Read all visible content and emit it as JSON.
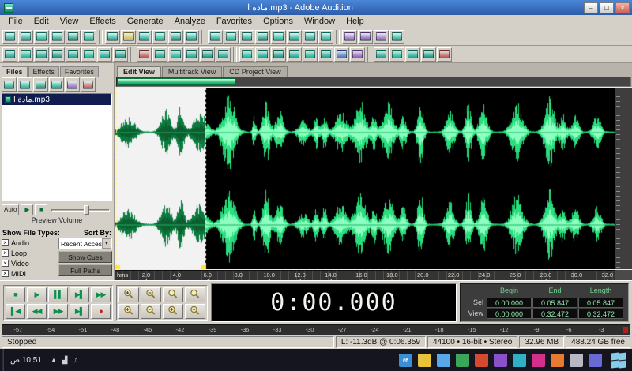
{
  "window": {
    "title": "مادة ا.mp3 - Adobe Audition",
    "controls": [
      {
        "name": "minimize-button",
        "glyph": "–"
      },
      {
        "name": "maximize-button",
        "glyph": "□"
      },
      {
        "name": "close-button",
        "glyph": "×"
      }
    ]
  },
  "menu": {
    "items": [
      "File",
      "Edit",
      "View",
      "Effects",
      "Generate",
      "Analyze",
      "Favorites",
      "Options",
      "Window",
      "Help"
    ]
  },
  "toolbar_row1": [
    {
      "name": "toolbar1-icon-01",
      "color": "#0fa08c"
    },
    {
      "name": "toolbar1-icon-02",
      "color": "#0fa08c"
    },
    {
      "name": "toolbar1-icon-03",
      "color": "#12b096"
    },
    {
      "name": "toolbar1-icon-04",
      "color": "#0fa08c"
    },
    {
      "name": "toolbar1-icon-05",
      "color": "#0d8f7c"
    },
    {
      "name": "toolbar1-icon-06",
      "color": "#12b096"
    },
    {
      "sep": true
    },
    {
      "name": "toolbar1-icon-07",
      "color": "#0fa08c"
    },
    {
      "name": "toolbar1-icon-08",
      "color": "#d4b23c"
    },
    {
      "name": "toolbar1-icon-09",
      "color": "#0fa08c"
    },
    {
      "name": "toolbar1-icon-10",
      "color": "#12b096"
    },
    {
      "name": "toolbar1-icon-11",
      "color": "#0d8f7c"
    },
    {
      "name": "toolbar1-icon-12",
      "color": "#0fa08c"
    },
    {
      "sep": true
    },
    {
      "name": "toolbar1-icon-13",
      "color": "#0fa08c"
    },
    {
      "name": "toolbar1-icon-14",
      "color": "#12b096"
    },
    {
      "name": "toolbar1-icon-15",
      "color": "#0fa08c"
    },
    {
      "name": "toolbar1-icon-16",
      "color": "#0d8f7c"
    },
    {
      "name": "toolbar1-icon-17",
      "color": "#12b096"
    },
    {
      "name": "toolbar1-icon-18",
      "color": "#0fa08c"
    },
    {
      "name": "toolbar1-icon-19",
      "color": "#0fa08c"
    },
    {
      "name": "toolbar1-icon-20",
      "color": "#12b096"
    },
    {
      "sep": true
    },
    {
      "name": "toolbar1-icon-21",
      "color": "#9a50c0"
    },
    {
      "name": "toolbar1-icon-22",
      "color": "#8a44b0"
    },
    {
      "name": "toolbar1-icon-23",
      "color": "#9a50c0"
    },
    {
      "name": "toolbar1-icon-24",
      "color": "#0fa08c"
    }
  ],
  "toolbar_row2": [
    {
      "name": "toolbar2-icon-01",
      "color": "#0fa08c"
    },
    {
      "name": "toolbar2-icon-02",
      "color": "#12b096"
    },
    {
      "name": "toolbar2-icon-03",
      "color": "#0fa08c"
    },
    {
      "name": "toolbar2-icon-04",
      "color": "#0d8f7c"
    },
    {
      "name": "toolbar2-icon-05",
      "color": "#0fa08c"
    },
    {
      "name": "toolbar2-icon-06",
      "color": "#12b096"
    },
    {
      "name": "toolbar2-icon-07",
      "color": "#0fa08c"
    },
    {
      "name": "toolbar2-icon-08",
      "color": "#0d8f7c"
    },
    {
      "sep": true
    },
    {
      "name": "toolbar2-icon-09",
      "color": "#c24848"
    },
    {
      "name": "toolbar2-icon-10",
      "color": "#0fa08c"
    },
    {
      "name": "toolbar2-icon-11",
      "color": "#12b096"
    },
    {
      "name": "toolbar2-icon-12",
      "color": "#0fa08c"
    },
    {
      "name": "toolbar2-icon-13",
      "color": "#0d8f7c"
    },
    {
      "name": "toolbar2-icon-14",
      "color": "#0fa08c"
    },
    {
      "sep": true
    },
    {
      "name": "toolbar2-icon-15",
      "color": "#12b096"
    },
    {
      "name": "toolbar2-icon-16",
      "color": "#0fa08c"
    },
    {
      "name": "toolbar2-icon-17",
      "color": "#0d8f7c"
    },
    {
      "name": "toolbar2-icon-18",
      "color": "#0fa08c"
    },
    {
      "name": "toolbar2-icon-19",
      "color": "#12b096"
    },
    {
      "name": "toolbar2-icon-20",
      "color": "#0fa08c"
    },
    {
      "name": "toolbar2-icon-21",
      "color": "#4868c8"
    },
    {
      "name": "toolbar2-icon-22",
      "color": "#9a50c0"
    },
    {
      "sep": true
    },
    {
      "name": "toolbar2-icon-23",
      "color": "#0fa08c"
    },
    {
      "name": "toolbar2-icon-24",
      "color": "#12b096"
    },
    {
      "name": "toolbar2-icon-25",
      "color": "#0fa08c"
    },
    {
      "name": "toolbar2-icon-26",
      "color": "#0d8f7c"
    },
    {
      "name": "toolbar2-icon-27",
      "color": "#c24848"
    }
  ],
  "files_panel": {
    "tabs": [
      {
        "label": "Files",
        "active": true
      },
      {
        "label": "Effects",
        "active": false
      },
      {
        "label": "Favorites",
        "active": false
      }
    ],
    "toolbar": [
      {
        "name": "files-import-icon",
        "color": "#0fa08c"
      },
      {
        "name": "files-close-file-icon",
        "color": "#12b096"
      },
      {
        "name": "files-edit-icon",
        "color": "#0d8f7c"
      },
      {
        "name": "files-insert-multitrack-icon",
        "color": "#0fa08c"
      },
      {
        "name": "files-insert-cd-icon",
        "color": "#9a50c0"
      },
      {
        "name": "files-delete-icon",
        "color": "#c24848"
      }
    ],
    "items": [
      {
        "label": "مادة ا.mp3",
        "selected": true
      }
    ],
    "auto_label": "Auto",
    "preview_buttons": [
      {
        "name": "preview-play-button",
        "glyph": "▶"
      },
      {
        "name": "preview-stop-button",
        "glyph": "■"
      }
    ],
    "preview_volume_label": "Preview Volume",
    "show_file_types_label": "Show File Types:",
    "sort_by_label": "Sort By:",
    "file_types": [
      {
        "label": "Audio",
        "checked": true
      },
      {
        "label": "Loop",
        "checked": true
      },
      {
        "label": "Video",
        "checked": true
      },
      {
        "label": "MIDI",
        "checked": true
      }
    ],
    "sort_value": "Recent Access",
    "buttons": [
      {
        "name": "show-cues-button",
        "label": "Show Cues"
      },
      {
        "name": "full-paths-button",
        "label": "Full Paths"
      }
    ]
  },
  "view_tabs": [
    {
      "label": "Edit View",
      "active": true
    },
    {
      "label": "Multitrack View",
      "active": false
    },
    {
      "label": "CD Project View",
      "active": false
    }
  ],
  "waveform": {
    "duration_s": 32.472,
    "selection_start_s": 0.0,
    "selection_end_s": 5.847,
    "cursor_s": 0.0,
    "color_wave": "#2ade7e",
    "color_wave_core": "#8dffc0",
    "color_wave_selected": "#0b7a3e",
    "color_wave_selected_core": "#0f5c30",
    "background": "#000000",
    "selection_background": "#f2f2f2"
  },
  "timeline": {
    "unit": "hms",
    "labels": [
      2,
      4,
      6,
      8,
      10,
      12,
      14,
      16,
      18,
      20,
      22,
      24,
      26,
      28,
      30,
      32
    ]
  },
  "transport": [
    {
      "name": "stop-button",
      "glyph": "■",
      "color": "#0b8f4e"
    },
    {
      "name": "play-button",
      "glyph": "▶",
      "color": "#0b8f4e"
    },
    {
      "name": "pause-button",
      "glyph": "▌▌",
      "color": "#0b8f4e"
    },
    {
      "name": "play-to-end-button",
      "glyph": "▶▌",
      "color": "#0b8f4e"
    },
    {
      "name": "play-looped-button",
      "glyph": "▶▶",
      "color": "#0b8f4e"
    },
    {
      "name": "go-to-beginning-button",
      "glyph": "▌◀",
      "color": "#0b8f4e"
    },
    {
      "name": "rewind-button",
      "glyph": "◀◀",
      "color": "#0b8f4e"
    },
    {
      "name": "fast-forward-button",
      "glyph": "▶▶",
      "color": "#0b8f4e"
    },
    {
      "name": "go-to-end-button",
      "glyph": "▶▌",
      "color": "#0b8f4e"
    },
    {
      "name": "record-button",
      "glyph": "●",
      "color": "#c02020"
    }
  ],
  "zoom": [
    {
      "name": "zoom-in-horizontal-button",
      "sign": "+"
    },
    {
      "name": "zoom-out-horizontal-button",
      "sign": "-"
    },
    {
      "name": "zoom-full-button",
      "sign": ""
    },
    {
      "name": "zoom-to-selection-button",
      "sign": ""
    },
    {
      "name": "zoom-in-vertical-button",
      "sign": "+"
    },
    {
      "name": "zoom-out-vertical-button",
      "sign": "-"
    },
    {
      "name": "zoom-to-left-edge-button",
      "sign": "+"
    },
    {
      "name": "zoom-to-right-edge-button",
      "sign": "+"
    }
  ],
  "time_display": "0:00.000",
  "selection_panel": {
    "headers": [
      "Begin",
      "End",
      "Length"
    ],
    "rows": [
      {
        "label": "Sel",
        "values": [
          "0:00.000",
          "0:05.847",
          "0:05.847"
        ]
      },
      {
        "label": "View",
        "values": [
          "0:00.000",
          "0:32.472",
          "0:32.472"
        ]
      }
    ]
  },
  "meter": {
    "labels": [
      -57,
      -54,
      -51,
      -48,
      -45,
      -42,
      -39,
      -36,
      -33,
      -30,
      -27,
      -24,
      -21,
      -18,
      -15,
      -12,
      -9,
      -6,
      -3
    ]
  },
  "status_bar": {
    "left": "Stopped",
    "segments": [
      "L: -11.3dB @ 0:06.359",
      "44100 • 16-bit • Stereo",
      "32.96 MB",
      "488.24 GB free"
    ]
  },
  "taskbar": {
    "clock": "10:51 ص",
    "tray": [
      {
        "name": "tray-show-hidden-icon",
        "glyph": "▲"
      },
      {
        "name": "tray-network-icon",
        "glyph": "▟"
      },
      {
        "name": "tray-volume-icon",
        "glyph": "♫"
      }
    ],
    "apps": [
      {
        "name": "taskbar-app-internet-explorer",
        "color": "#3a8fd4",
        "glyph": "e"
      },
      {
        "name": "taskbar-app-file-explorer",
        "color": "#e8c33a",
        "glyph": ""
      },
      {
        "name": "taskbar-app-3",
        "color": "#58a8e8",
        "glyph": ""
      },
      {
        "name": "taskbar-app-4",
        "color": "#3aa657",
        "glyph": ""
      },
      {
        "name": "taskbar-app-5",
        "color": "#d44a2f",
        "glyph": ""
      },
      {
        "name": "taskbar-app-6",
        "color": "#8a50c8",
        "glyph": ""
      },
      {
        "name": "taskbar-app-7",
        "color": "#2fb0c4",
        "glyph": ""
      },
      {
        "name": "taskbar-app-8",
        "color": "#d42f8a",
        "glyph": ""
      },
      {
        "name": "taskbar-app-9",
        "color": "#e87a2f",
        "glyph": ""
      },
      {
        "name": "taskbar-app-10",
        "color": "#b8b8c2",
        "glyph": ""
      },
      {
        "name": "taskbar-app-11",
        "color": "#6a6ad4",
        "glyph": ""
      }
    ]
  }
}
